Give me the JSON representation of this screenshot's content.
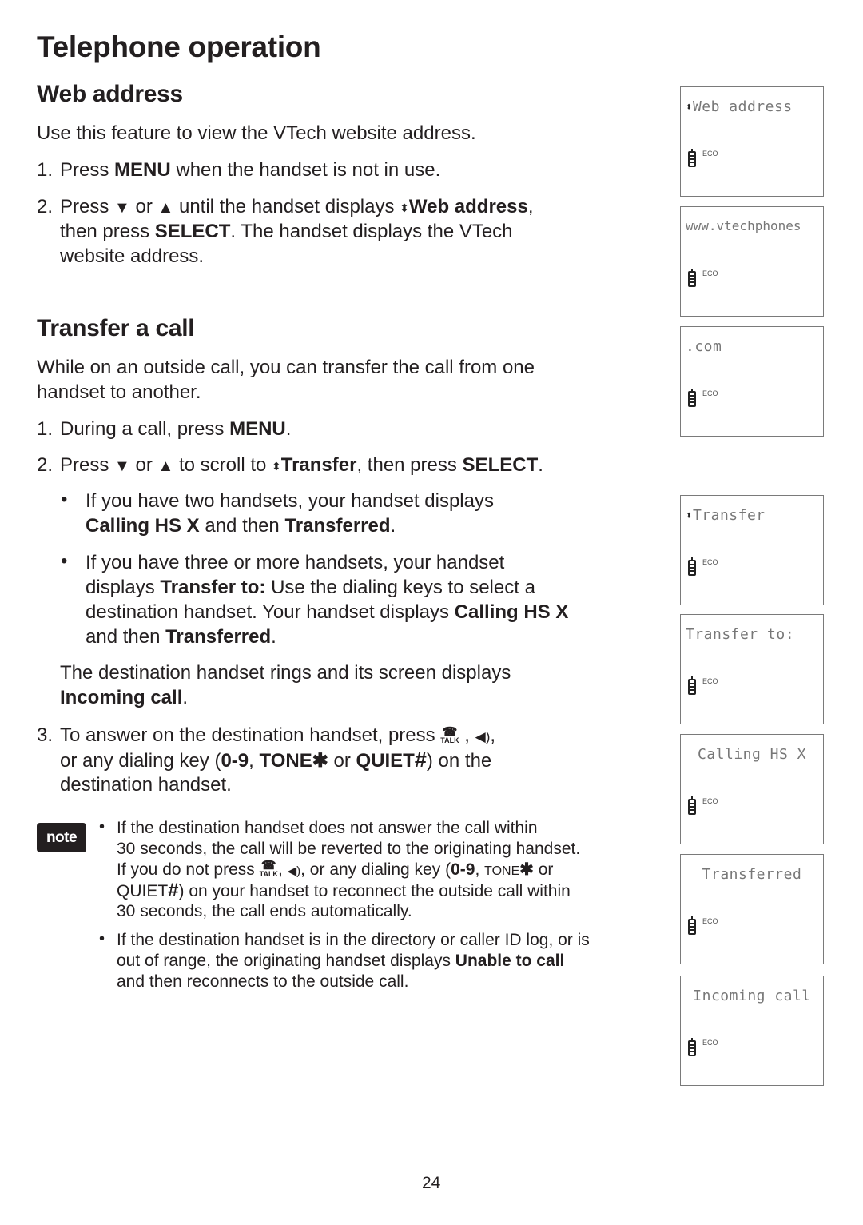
{
  "page": {
    "title": "Telephone operation",
    "page_number": "24"
  },
  "web_address": {
    "heading": "Web address",
    "intro": "Use this feature to view the VTech website address.",
    "step1": {
      "num": "1.",
      "a": "Press ",
      "b": "MENU",
      "c": " when the handset is not in use."
    },
    "step2": {
      "num": "2.",
      "a": "Press ",
      "down": "▼",
      "or": " or ",
      "up": "▲",
      "b": " until the handset displays ",
      "arrow": "⬍",
      "c": "Web address",
      "d": ",",
      "e": "then press ",
      "f": "SELECT",
      "g": ". The handset displays the VTech",
      "h": "website address."
    }
  },
  "transfer": {
    "heading": "Transfer a call",
    "intro_l1": "While on an outside call, you can transfer the call from one",
    "intro_l2": "handset to another.",
    "step1": {
      "num": "1.",
      "a": "During a call, press ",
      "b": "MENU",
      "c": "."
    },
    "step2": {
      "num": "2.",
      "a": "Press ",
      "down": "▼",
      "or": " or ",
      "up": "▲",
      "b": " to scroll to ",
      "arrow": "⬍",
      "c": "Transfer",
      "d": ", then press ",
      "e": "SELECT",
      "f": "."
    },
    "bullet1": {
      "l1": "If you have two handsets, your handset displays",
      "b1": "Calling HS X",
      "m": " and then ",
      "b2": "Transferred",
      "end": "."
    },
    "bullet2": {
      "l1": "If you have three or more handsets, your handset",
      "a": "displays ",
      "b1": "Transfer to:",
      "c": " Use the dialing keys to select a",
      "l3": "destination handset. Your handset displays ",
      "b2": "Calling HS X",
      "d": "and then ",
      "b3": "Transferred",
      "end": "."
    },
    "dest_l1": "The destination handset rings and its screen displays",
    "dest_b": "Incoming call",
    "dest_end": ".",
    "step3": {
      "num": "3.",
      "a": "To answer on the destination handset, press ",
      "talk": "TALK",
      "c": " , ",
      "speaker": "🔊",
      "d": ",",
      "e": "or any dialing key (",
      "f": "0-9",
      "g": ", ",
      "h": "TONE",
      "star": "✱",
      "i": " or ",
      "j": "QUIET",
      "hash": "#",
      "k": ") on the",
      "l": "destination handset."
    }
  },
  "note": {
    "badge": "note",
    "bullet1": {
      "l1": "If the destination handset does not answer the call within",
      "l2": "30 seconds, the call will be reverted to the originating handset.",
      "l3a": "If you do not press ",
      "talk": "TALK",
      "l3b": ", ",
      "speaker": "🔊",
      "l3c": ", or any dialing key (",
      "l3d": "0-9",
      "l3e": ", ",
      "tone": "TONE",
      "star": "✱",
      "l3f": " or",
      "l4a": "QUIET",
      "hash": "#",
      "l4b": ") on your handset to reconnect the outside call within",
      "l5": "30 seconds, the call ends automatically."
    },
    "bullet2": {
      "l1": "If the destination handset is in the directory or caller ID log, or is",
      "l2a": "out of range, the originating handset displays ",
      "l2b": "Unable to call",
      "l3": "and then reconnects to the outside call."
    }
  },
  "screens": [
    {
      "text": "Web address",
      "scroll_arrow": "⬍",
      "status": "ECO"
    },
    {
      "text": "www.vtechphones",
      "status": "ECO"
    },
    {
      "text": ".com",
      "status": "ECO"
    },
    {
      "text": "Transfer",
      "scroll_arrow": "⬍",
      "status": "ECO"
    },
    {
      "text": "Transfer to:",
      "status": "ECO"
    },
    {
      "text": "Calling HS X",
      "status": "ECO"
    },
    {
      "text": "Transferred",
      "status": "ECO"
    },
    {
      "text": "Incoming call",
      "status": "ECO"
    }
  ]
}
